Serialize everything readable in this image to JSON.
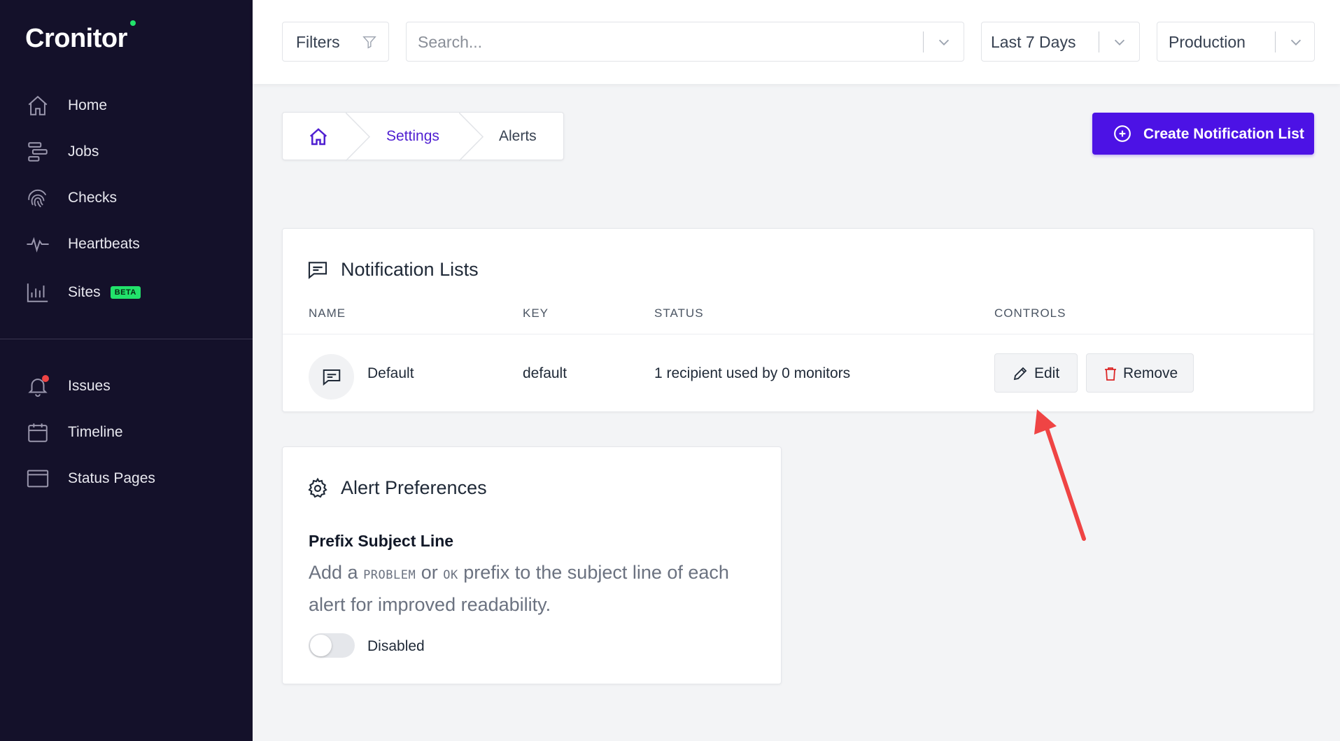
{
  "app": {
    "name": "Cronitor"
  },
  "sidebar": {
    "items": [
      {
        "label": "Home",
        "icon": "home-icon"
      },
      {
        "label": "Jobs",
        "icon": "jobs-icon"
      },
      {
        "label": "Checks",
        "icon": "fingerprint-icon"
      },
      {
        "label": "Heartbeats",
        "icon": "heartbeat-icon"
      },
      {
        "label": "Sites",
        "icon": "bar-chart-icon",
        "badge": "BETA"
      }
    ],
    "secondary_items": [
      {
        "label": "Issues",
        "icon": "bell-icon"
      },
      {
        "label": "Timeline",
        "icon": "calendar-icon"
      },
      {
        "label": "Status Pages",
        "icon": "browser-window-icon"
      }
    ]
  },
  "topbar": {
    "filters_label": "Filters",
    "search_placeholder": "Search...",
    "date_range": "Last 7 Days",
    "environment": "Production"
  },
  "breadcrumb": {
    "items": [
      "Settings",
      "Alerts"
    ]
  },
  "create_button": {
    "label": "Create Notification List"
  },
  "notification_lists": {
    "title": "Notification Lists",
    "columns": [
      "NAME",
      "KEY",
      "STATUS",
      "CONTROLS"
    ],
    "rows": [
      {
        "name": "Default",
        "key": "default",
        "status": "1 recipient used by 0 monitors"
      }
    ],
    "edit_label": "Edit",
    "remove_label": "Remove"
  },
  "alert_preferences": {
    "title": "Alert Preferences",
    "setting_title": "Prefix Subject Line",
    "desc_part1": "Add a ",
    "code1": "PROBLEM",
    "desc_part2": " or ",
    "code2": "OK",
    "desc_part3": " prefix to the subject line of each alert for improved readability.",
    "toggle_label": "Disabled",
    "toggle_on": false
  },
  "colors": {
    "sidebar_bg": "#14112a",
    "accent": "#4c12e5",
    "beta_badge": "#22e36b",
    "danger": "#dc2626",
    "annotation_arrow": "#ef4444"
  }
}
